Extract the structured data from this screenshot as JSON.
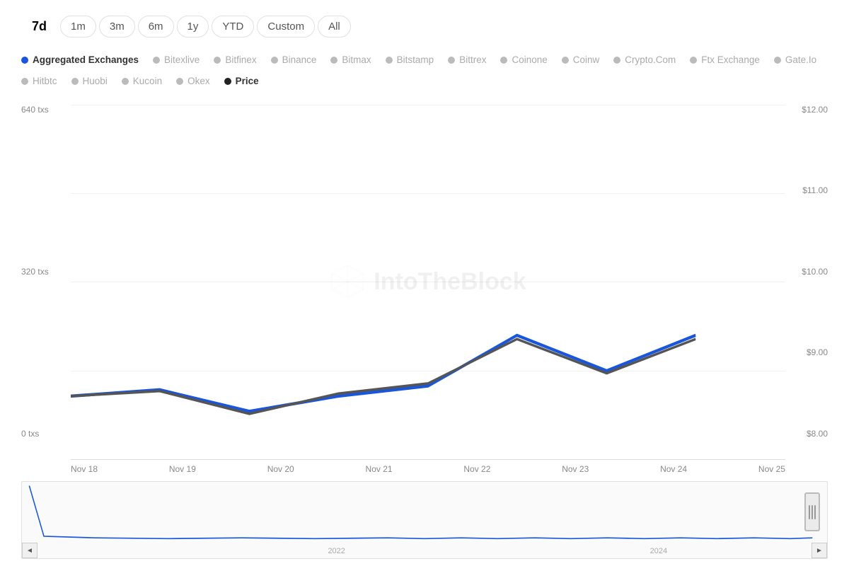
{
  "timeRange": {
    "buttons": [
      {
        "label": "7d",
        "active": true
      },
      {
        "label": "1m",
        "active": false
      },
      {
        "label": "3m",
        "active": false
      },
      {
        "label": "6m",
        "active": false
      },
      {
        "label": "1y",
        "active": false
      },
      {
        "label": "YTD",
        "active": false
      },
      {
        "label": "Custom",
        "active": false
      },
      {
        "label": "All",
        "active": false
      }
    ]
  },
  "legend": {
    "items": [
      {
        "label": "Aggregated Exchanges",
        "color": "#1a56db",
        "active": true
      },
      {
        "label": "Bitexlive",
        "color": "#bbb",
        "active": false
      },
      {
        "label": "Bitfinex",
        "color": "#bbb",
        "active": false
      },
      {
        "label": "Binance",
        "color": "#bbb",
        "active": false
      },
      {
        "label": "Bitmax",
        "color": "#bbb",
        "active": false
      },
      {
        "label": "Bitstamp",
        "color": "#bbb",
        "active": false
      },
      {
        "label": "Bittrex",
        "color": "#bbb",
        "active": false
      },
      {
        "label": "Coinone",
        "color": "#bbb",
        "active": false
      },
      {
        "label": "Coinw",
        "color": "#bbb",
        "active": false
      },
      {
        "label": "Crypto.Com",
        "color": "#bbb",
        "active": false
      },
      {
        "label": "Ftx Exchange",
        "color": "#bbb",
        "active": false
      },
      {
        "label": "Gate.Io",
        "color": "#bbb",
        "active": false
      },
      {
        "label": "Hitbtc",
        "color": "#bbb",
        "active": false
      },
      {
        "label": "Huobi",
        "color": "#bbb",
        "active": false
      },
      {
        "label": "Kucoin",
        "color": "#bbb",
        "active": false
      },
      {
        "label": "Okex",
        "color": "#bbb",
        "active": false
      },
      {
        "label": "Price",
        "color": "#222",
        "active": true
      }
    ]
  },
  "yAxisLeft": {
    "labels": [
      "640 txs",
      "320 txs",
      "0 txs"
    ]
  },
  "yAxisRight": {
    "labels": [
      "$12.00",
      "$11.00",
      "$10.00",
      "$9.00",
      "$8.00"
    ]
  },
  "xAxis": {
    "labels": [
      "Nov 18",
      "Nov 19",
      "Nov 20",
      "Nov 21",
      "Nov 22",
      "Nov 23",
      "Nov 24",
      "Nov 25"
    ]
  },
  "miniChart": {
    "yearLabels": [
      "2022",
      "2024"
    ],
    "navLeft": "◄",
    "navRight": "►"
  },
  "watermark": "IntoTheBlock"
}
